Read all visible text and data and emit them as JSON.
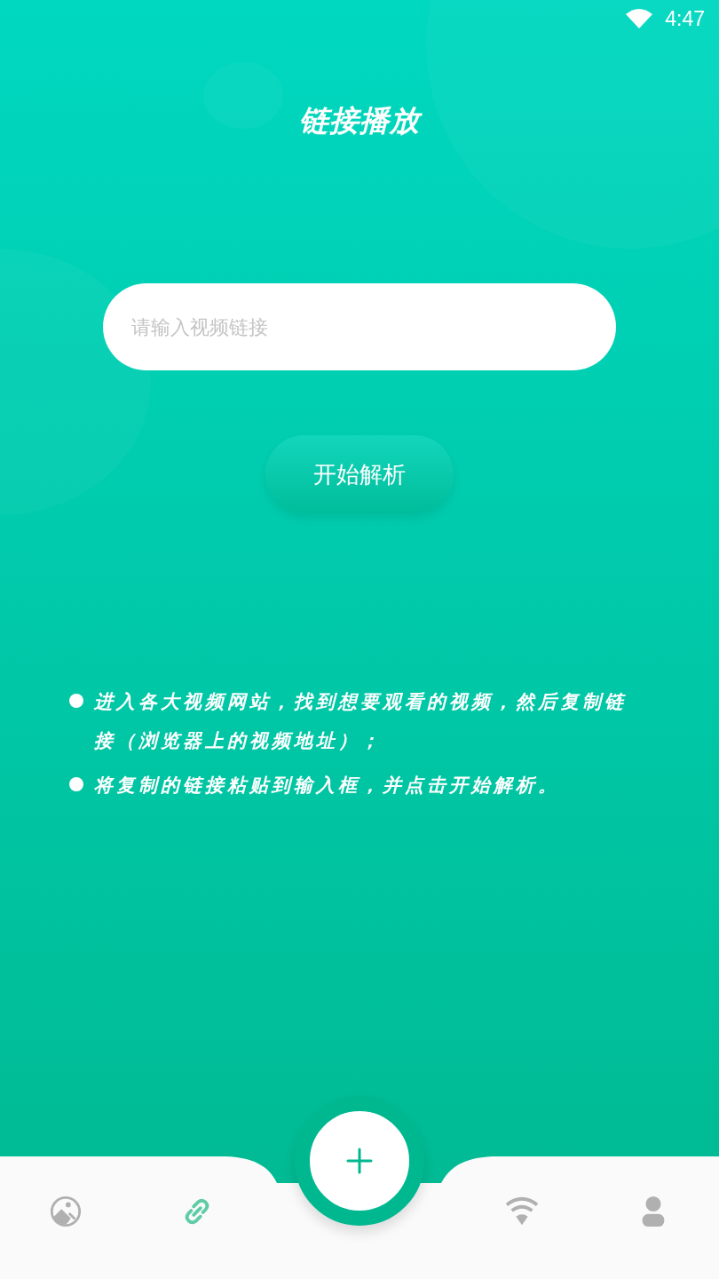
{
  "status_bar": {
    "time": "4:47"
  },
  "title": "链接播放",
  "link_field": {
    "placeholder": "请输入视频链接"
  },
  "parse_button": "开始解析",
  "tips": [
    "进入各大视频网站，找到想要观看的视频，然后复制链接（浏览器上的视频地址）；",
    "将复制的链接粘贴到输入框，并点击开始解析。"
  ],
  "bottom_nav": [
    {
      "kind": "gallery",
      "selected": false
    },
    {
      "kind": "link",
      "selected": true
    },
    {
      "kind": "add",
      "selected": false
    },
    {
      "kind": "wifi",
      "selected": false
    },
    {
      "kind": "profile",
      "selected": false
    }
  ]
}
